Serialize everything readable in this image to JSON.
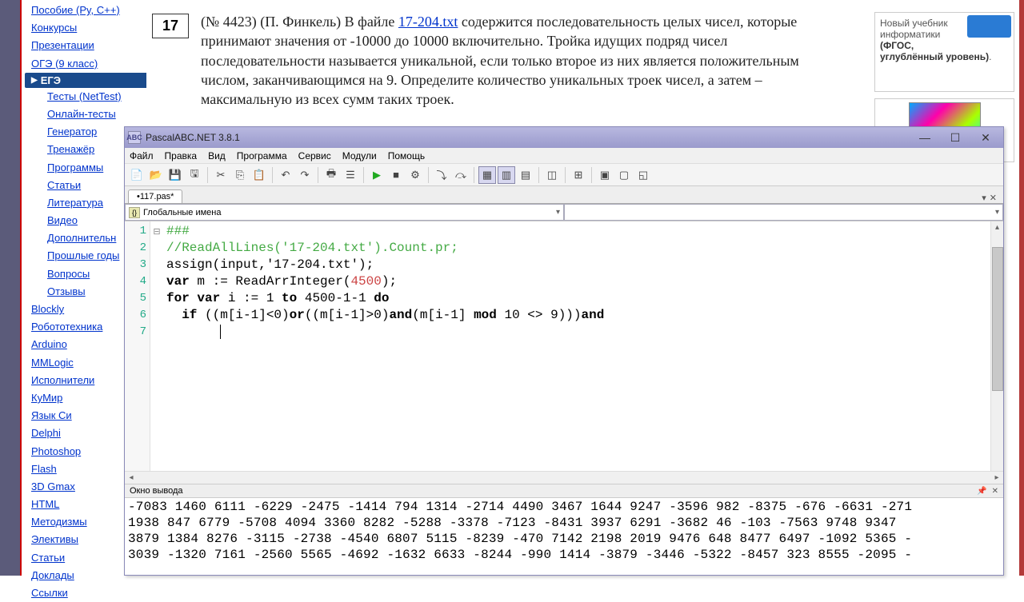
{
  "sidebar": {
    "top_items": [
      "Пособие (Py, C++)",
      "Конкурсы",
      "Презентации",
      "ОГЭ (9 класс)"
    ],
    "section": "ЕГЭ",
    "sub_items": [
      "Тесты (NetTest)",
      "Онлайн-тесты",
      "Генератор",
      "Тренажёр",
      "Программы",
      "Статьи",
      "Литература",
      "Видео",
      "Дополнительн",
      "Прошлые годы",
      "Вопросы",
      "Отзывы"
    ],
    "bottom_items": [
      "Blockly",
      "Робототехника",
      "Arduino",
      "MMLogic",
      "Исполнители",
      "КуМир",
      "Язык Си",
      "Delphi",
      "Photoshop",
      "Flash",
      "3D Gmax",
      "HTML",
      "Методизмы",
      "Элективы",
      "Статьи",
      "Доклады",
      "Ссылки"
    ]
  },
  "task": {
    "number": "17",
    "prefix": "(№ 4423) (П. Финкель) В файле ",
    "file_link": "17-204.txt",
    "body": " содержится последовательность целых чисел, которые принимают значения от -10000 до 10000 включительно. Тройка идущих подряд чисел последовательности называется уникальной, если только второе из них является положительным числом, заканчивающимся на 9. Определите количество уникальных троек чисел, а затем – максимальную из всех сумм таких троек."
  },
  "ad": {
    "line1": "Новый учебник информатики ",
    "bold": "(ФГОС, углублённый уровень)",
    "trail": "."
  },
  "ide": {
    "title": "PascalABC.NET 3.8.1",
    "menu": [
      "Файл",
      "Правка",
      "Вид",
      "Программа",
      "Сервис",
      "Модули",
      "Помощь"
    ],
    "tab": "•117.pas*",
    "combo": "Глобальные имена",
    "gutter": [
      "1",
      "2",
      "3",
      "4",
      "5",
      "6",
      "7"
    ],
    "fold": [
      "⊟",
      "",
      "",
      "",
      "",
      "",
      ""
    ],
    "code": {
      "l1": {
        "a": "###"
      },
      "l2": {
        "a": "//ReadAllLines('17-204.txt').Count.pr;"
      },
      "l3": {
        "a": "assign(input,",
        "b": "'17-204.txt'",
        "c": ");"
      },
      "l4": {
        "a": "var",
        "b": " m := ReadArrInteger(",
        "c": "4500",
        "d": ");"
      },
      "l5": {
        "a": "for",
        "b": " ",
        "c": "var",
        "d": " i := 1 ",
        "e": "to",
        "f": " 4500-1-1 ",
        "g": "do"
      },
      "l6": {
        "a": "  ",
        "b": "if",
        "c": " ((m[i-1]<0)",
        "d": "or",
        "e": "((m[i-1]>0)",
        "f": "and",
        "g": "(m[i-1] ",
        "h": "mod",
        "i": " 10 <> 9)))",
        "j": "and"
      }
    },
    "output_title": "Окно вывода",
    "output": "-7083 1460 6111 -6229 -2475 -1414 794 1314 -2714 4490 3467 1644 9247 -3596 982 -8375 -676 -6631 -271\n1938 847 6779 -5708 4094 3360 8282 -5288 -3378 -7123 -8431 3937 6291 -3682 46 -103 -7563 9748 9347\n3879 1384 8276 -3115 -2738 -4540 6807 5115 -8239 -470 7142 2198 2019 9476 648 8477 6497 -1092 5365 -\n3039 -1320 7161 -2560 5565 -4692 -1632 6633 -8244 -990 1414 -3879 -3446 -5322 -8457 323 8555 -2095 -"
  }
}
